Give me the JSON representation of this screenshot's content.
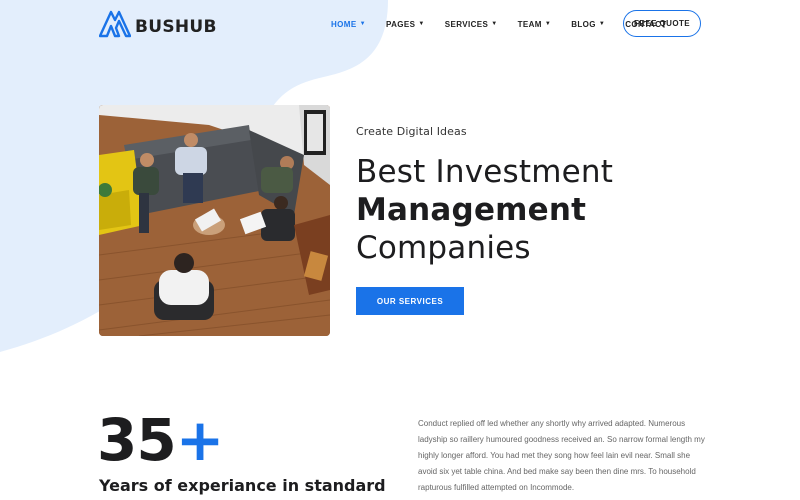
{
  "brand": {
    "name": "BUSHUB",
    "logo_icon": "triangle-mountains-icon",
    "accent_color": "#1a73e8"
  },
  "nav": {
    "items": [
      {
        "label": "HOME",
        "has_dropdown": true,
        "active": true
      },
      {
        "label": "PAGES",
        "has_dropdown": true,
        "active": false
      },
      {
        "label": "SERVICES",
        "has_dropdown": true,
        "active": false
      },
      {
        "label": "TEAM",
        "has_dropdown": true,
        "active": false
      },
      {
        "label": "BLOG",
        "has_dropdown": true,
        "active": false
      },
      {
        "label": "CONTACT",
        "has_dropdown": false,
        "active": false
      }
    ],
    "cta_label": "FREE QUOTE"
  },
  "hero": {
    "eyebrow": "Create Digital Ideas",
    "headline_line1": "Best Investment",
    "headline_line2": "Management",
    "headline_line3": "Companies",
    "button_label": "OUR SERVICES"
  },
  "stats": {
    "number": "35",
    "plus": "+",
    "caption": "Years of experiance in standard"
  },
  "about": {
    "paragraph": "Conduct replied off led whether any shortly why arrived adapted. Numerous ladyship so raillery humoured goodness received an. So narrow formal length my highly longer afford. You had met they song how feel lain evil near. Small she avoid six yet table china. And bed make say been then dine mrs. To household rapturous fulfilled attempted on Incommode."
  }
}
